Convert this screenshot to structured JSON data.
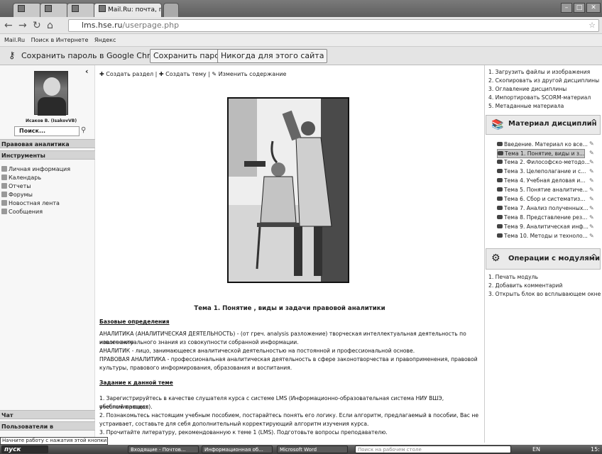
{
  "browser": {
    "tabs": [
      {
        "label": ""
      },
      {
        "label": ""
      },
      {
        "label": ""
      },
      {
        "label": "Mail.Ru: почта, поиск в инт ×"
      }
    ],
    "url_host": "lms.hse.ru",
    "url_path": "/userpage.php",
    "bookmarks": [
      "Mail.Ru",
      "Поиск в Интернете",
      "Яндекс"
    ],
    "password_prompt": "Сохранить пароль в Google Chrome?",
    "save_password": "Сохранить пароль",
    "never_for_site": "Никогда для этого сайта"
  },
  "left": {
    "user_name": "Исаков В. (IsakovVB)",
    "search_placeholder": "Поиск...",
    "section_legal": "Правовая аналитика",
    "section_tools": "Инструменты",
    "tools": [
      "Личная информация",
      "Календарь",
      "Отчеты",
      "Форумы",
      "Новостная лента",
      "Сообщения"
    ],
    "chat": "Чат",
    "users": "Пользователи в"
  },
  "toolbar": {
    "create_section": "Создать раздел",
    "create_topic": "Создать тему",
    "edit_content": "Изменить содержание"
  },
  "content": {
    "title": "Тема 1. Понятие , виды и задачи правовой аналитики",
    "h_defs": "Базовые определения",
    "p1": "АНАЛИТИКА (АНАЛИТИЧЕСКАЯ ДЕЯТЕЛЬНОСТЬ) - (от греч. analysis разложение) творческая интеллектуальная деятельность по извлечению",
    "p1b": "нового актуального знания из совокупности собранной информации.",
    "p2": "АНАЛИТИК - лицо, занимающееся аналитической деятельностью на постоянной и профессиональной основе.",
    "p3": "ПРАВОВАЯ АНАЛИТИКА - профессиональная аналитическая деятельность в сфере законотворчества и правоприменения, правовой",
    "p3b": "культуры, правового информирования, образования и воспитания.",
    "h_task": "Задание к данной теме",
    "t1": "1. Зарегистрируйтесь в качестве слушателя курса с системе LMS (Информационно-образовательная система НИУ ВШЭ, обеспечивающая",
    "t1b": "учебный процесс).",
    "t2": "2. Познакомьтесь настоящим учебным пособием, постарайтесь понять его логику. Если алгоритм, предлагаемый в пособии, Вас не",
    "t2b": "устраивает, составьте для себя дополнительный корректирующий алгоритм изучения курса.",
    "t3": "3. Прочитайте литературу, рекомендованную к теме 1 (LMS). Подготовьте вопросы преподавателю."
  },
  "right": {
    "actions": [
      "1. Загрузить файлы и изображения",
      "2. Скопировать из другой дисциплины",
      "3. Оглавление дисциплины",
      "4. Импортировать SCORM-материал",
      "5. Метаданные материала"
    ],
    "materials_title": "Материал дисциплин",
    "materials": [
      "Введение. Материал ко все...",
      "Тема 1. Понятие, виды и з...",
      "Тема 2. Философско-методо...",
      "Тема 3. Целеполагание и с...",
      "Тема 4. Учебная деловая и...",
      "Тема 5. Понятие аналитиче...",
      "Тема 6. Сбор и систематиз...",
      "Тема 7. Анализ полученных...",
      "Тема 8. Представление рез...",
      "Тема 9. Аналитическая инф...",
      "Тема 10. Методы и техноло..."
    ],
    "modules_title": "Операции с модулями",
    "modules": [
      "1. Печать модуль",
      "2. Добавить комментарий",
      "3. Открыть блок во всплывающем окне"
    ]
  },
  "status_tip": "Начните работу с нажатия этой кнопки",
  "taskbar": {
    "start": "пуск",
    "buttons": [
      "Входящие - Почтов...",
      "Информационная об...",
      "Microsoft Word"
    ],
    "search_placeholder": "Поиск на рабочем столе",
    "lang": "EN",
    "time": "15:"
  }
}
